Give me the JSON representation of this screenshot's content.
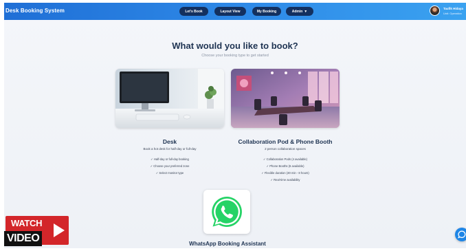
{
  "header": {
    "brand": "Desk Booking System",
    "nav": [
      {
        "label": "Let's Book"
      },
      {
        "label": "Layout View"
      },
      {
        "label": "My Booking"
      },
      {
        "label": "Admin",
        "caret": "▼"
      }
    ],
    "user": {
      "name": "Taufik Hidaya",
      "role": "Unit: Operation"
    }
  },
  "main": {
    "title": "What would you like to book?",
    "subtitle": "Choose your booking type to get started",
    "cards": [
      {
        "title": "Desk",
        "description": "Book a hot desk for half-day or full-day",
        "features": [
          "✓ Half-day or full-day booking",
          "✓ Choose your preferred zone",
          "✓ Select monitor type"
        ]
      },
      {
        "title": "Collaboration Pod & Phone Booth",
        "description": "2 person collaboration spaces",
        "features": [
          "✓ Collaboration Pods (4 available)",
          "✓ Phone Booths (6 available)",
          "✓ Flexible duration (30 min - 8 hours)",
          "✓ Real-time availability"
        ]
      }
    ],
    "whatsapp": {
      "title": "WhatsApp Booking Assistant",
      "icon": "whatsapp-icon"
    }
  },
  "overlay": {
    "watch_top": "WATCH",
    "watch_bottom": "VIDEO"
  },
  "colors": {
    "header_start": "#1f6fd6",
    "header_end": "#3aa2f0",
    "nav_pill": "#13305f",
    "heading": "#1e3352",
    "whatsapp": "#25d366",
    "watch_red": "#d3262a",
    "chat": "#1f86e6"
  },
  "icons": {
    "chat": "chat-bubble-icon",
    "play": "play-icon"
  }
}
